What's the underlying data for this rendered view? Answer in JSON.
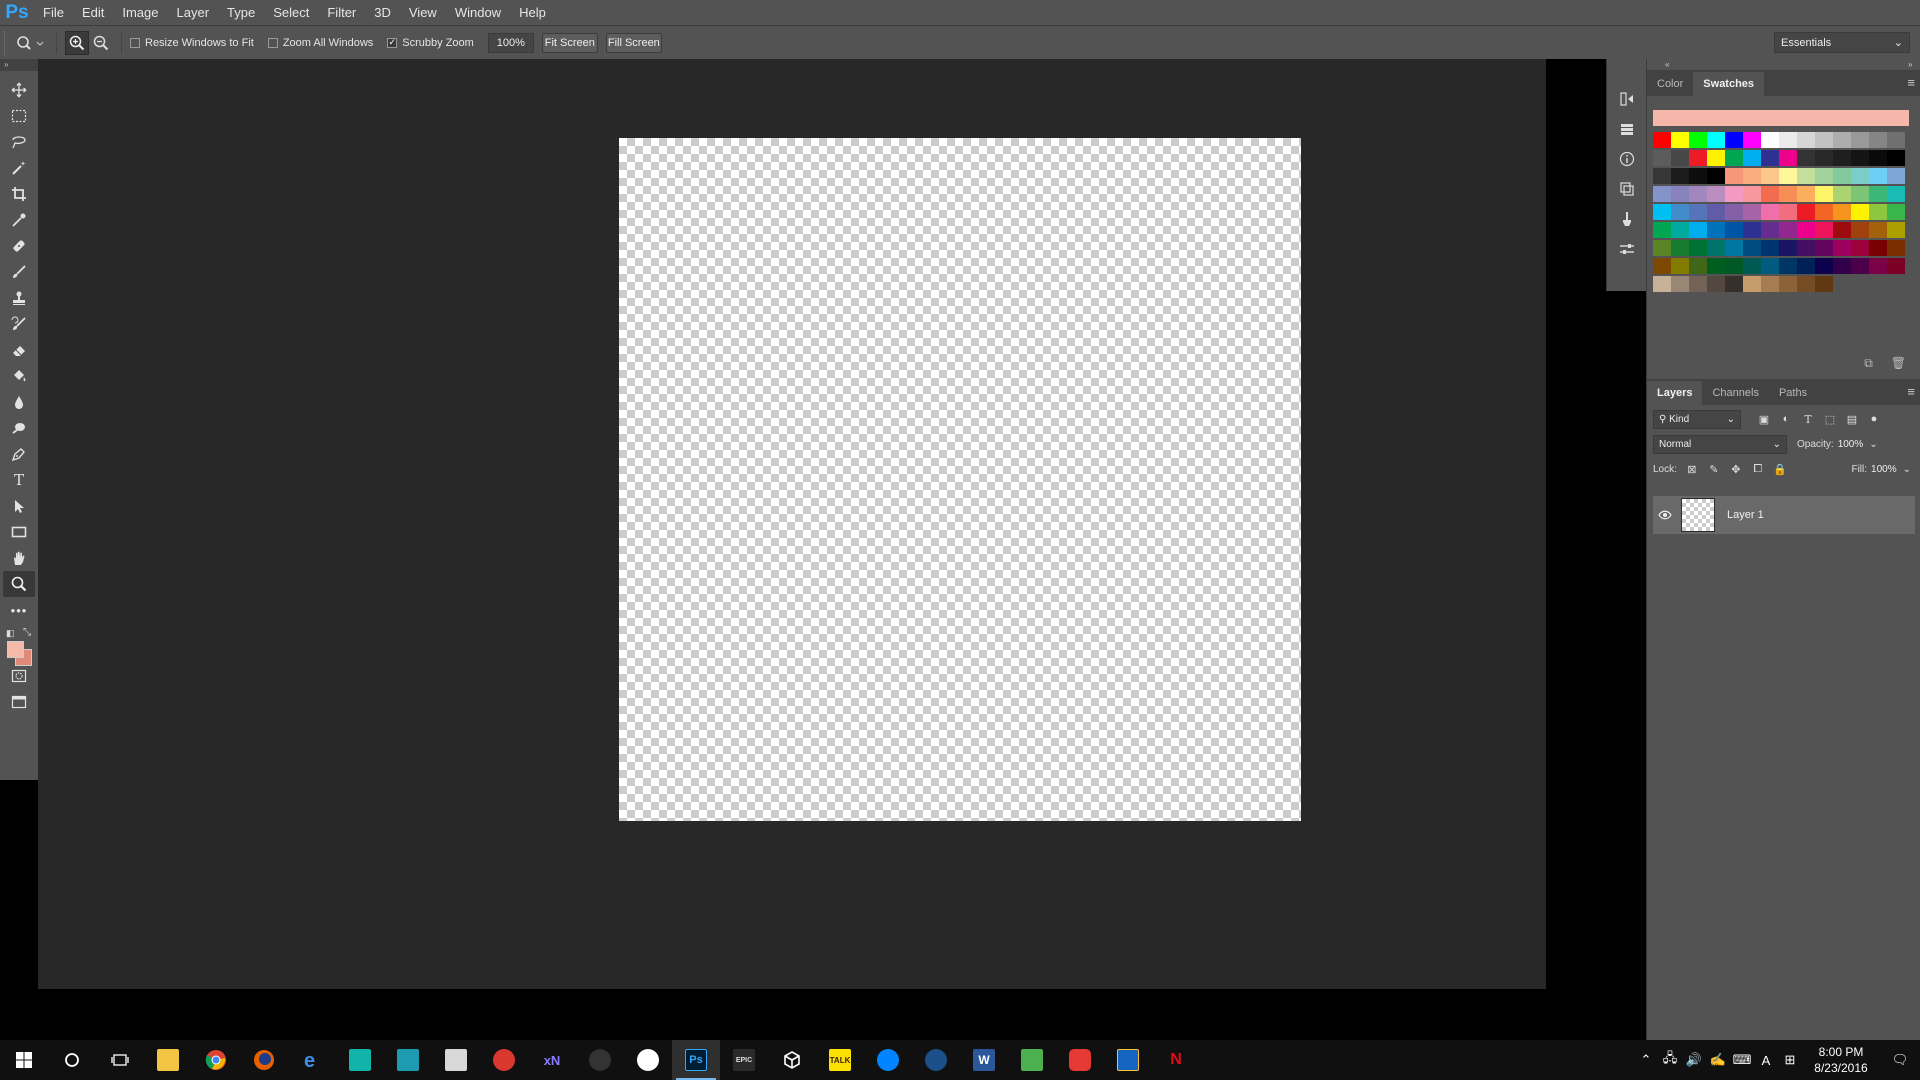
{
  "app": {
    "logo": "Ps"
  },
  "menu": [
    "File",
    "Edit",
    "Image",
    "Layer",
    "Type",
    "Select",
    "Filter",
    "3D",
    "View",
    "Window",
    "Help"
  ],
  "options": {
    "resize_windows_label": "Resize Windows to Fit",
    "resize_windows_checked": false,
    "zoom_all_label": "Zoom All Windows",
    "zoom_all_checked": false,
    "scrubby_zoom_label": "Scrubby Zoom",
    "scrubby_zoom_checked": true,
    "zoom_level": "100%",
    "fit_screen": "Fit Screen",
    "fill_screen": "Fill Screen",
    "workspace": "Essentials"
  },
  "tools": [
    "move-tool",
    "marquee-tool",
    "lasso-tool",
    "magic-wand-tool",
    "crop-tool",
    "eyedropper-tool",
    "healing-brush-tool",
    "brush-tool",
    "clone-stamp-tool",
    "history-brush-tool",
    "eraser-tool",
    "paint-bucket-tool",
    "blur-tool",
    "dodge-tool",
    "pen-tool",
    "type-tool",
    "path-selection-tool",
    "rectangle-tool",
    "hand-tool",
    "zoom-tool",
    "edit-toolbar"
  ],
  "selected_tool": "zoom-tool",
  "colors": {
    "foreground": "#f4b9a8",
    "background": "#e0887a"
  },
  "swatches_panel": {
    "tabs": [
      "Color",
      "Swatches"
    ],
    "active_tab": "Swatches",
    "rows": [
      [
        "#f5b7a9",
        "#f5b7a9",
        "#f5b7a9",
        "#f5b7a9",
        "#f5b7a9",
        "#f5b7a9",
        "#f5b7a9",
        "#f5b7a9",
        "#f5b7a9",
        "#f5b7a9",
        "#f5b7a9",
        "#f5b7a9",
        "#f5b7a9",
        "#f5b7a9",
        "#f5b7a9",
        "#f5b7a9"
      ],
      [
        "#ff0000",
        "#ffff00",
        "#00ff00",
        "#00ffff",
        "#0000ff",
        "#ff00ff",
        "#ffffff",
        "#ebebeb",
        "#d6d6d6",
        "#c2c2c2",
        "#adadad",
        "#999999",
        "#858585",
        "#707070"
      ],
      [
        "#5c5c5c",
        "#474747",
        "#ed1c24",
        "#fff200",
        "#00a651",
        "#00aeef",
        "#2e3192",
        "#ec008c",
        "#333333",
        "#292929",
        "#1f1f1f",
        "#141414",
        "#0a0a0a",
        "#000000"
      ],
      [
        "#363636",
        "#1c1c1c",
        "#0d0d0d",
        "#000000",
        "#f7977a",
        "#f9ad81",
        "#fdc68a",
        "#fff79a",
        "#c4df9b",
        "#a3d39c",
        "#82ca9d",
        "#7bcdc8",
        "#6ecff6",
        "#7ea7d8"
      ],
      [
        "#8493ca",
        "#8882be",
        "#a187be",
        "#bc8dbf",
        "#f49ac2",
        "#f6989d",
        "#f26c4f",
        "#f68e55",
        "#fbaf5d",
        "#fff568",
        "#acd372",
        "#7cc576",
        "#3bb878",
        "#1abbb4"
      ],
      [
        "#00bff3",
        "#438ccb",
        "#5574b9",
        "#605ca8",
        "#855fa8",
        "#a763a8",
        "#f06ea9",
        "#f26d7d",
        "#ed1c24",
        "#f26522",
        "#f7941d",
        "#fff200",
        "#8dc73f",
        "#39b54a"
      ],
      [
        "#00a651",
        "#00a99d",
        "#00aeef",
        "#0072bc",
        "#0054a6",
        "#2e3192",
        "#662d91",
        "#92278f",
        "#ec008c",
        "#ed145b",
        "#9e0b0f",
        "#a0410d",
        "#a36209",
        "#aba000"
      ],
      [
        "#598527",
        "#197b30",
        "#007236",
        "#00746b",
        "#0076a3",
        "#004b80",
        "#003471",
        "#1b1464",
        "#440e62",
        "#630460",
        "#9e005d",
        "#9e0039",
        "#790000",
        "#7b2e00"
      ],
      [
        "#7d4900",
        "#827b00",
        "#406618",
        "#005e20",
        "#005826",
        "#005952",
        "#005b7f",
        "#003663",
        "#002157",
        "#0d004c",
        "#32004b",
        "#4b0049",
        "#7b0046",
        "#7a0026"
      ],
      [
        "#c7b299",
        "#998675",
        "#736357",
        "#534741",
        "#37302a",
        "#c69c6d",
        "#a67c52",
        "#8c6239",
        "#754c24",
        "#603913"
      ]
    ]
  },
  "layers_panel": {
    "tabs": [
      "Layers",
      "Channels",
      "Paths"
    ],
    "active_tab": "Layers",
    "filter_kind": "Kind",
    "blend_mode": "Normal",
    "opacity_label": "Opacity:",
    "opacity": "100%",
    "lock_label": "Lock:",
    "fill_label": "Fill:",
    "fill": "100%",
    "layers": [
      {
        "name": "Layer 1",
        "visible": true
      }
    ]
  },
  "taskbar": {
    "apps": [
      "file-explorer",
      "chrome",
      "firefox",
      "edge",
      "app-1",
      "app-2",
      "app-3",
      "app-4",
      "xnview",
      "app-5",
      "app-6",
      "photoshop",
      "epic-games",
      "unity",
      "kakaotalk",
      "messenger",
      "steam",
      "word",
      "app-7",
      "app-8",
      "app-9",
      "netflix"
    ],
    "active_app": "photoshop",
    "xn_label": "xN",
    "ps_label": "Ps",
    "epic_label": "EPIC",
    "talk_label": "TALK",
    "word_label": "W",
    "netflix_label": "N",
    "ime_label": "A",
    "time": "8:00 PM",
    "date": "8/23/2016"
  }
}
